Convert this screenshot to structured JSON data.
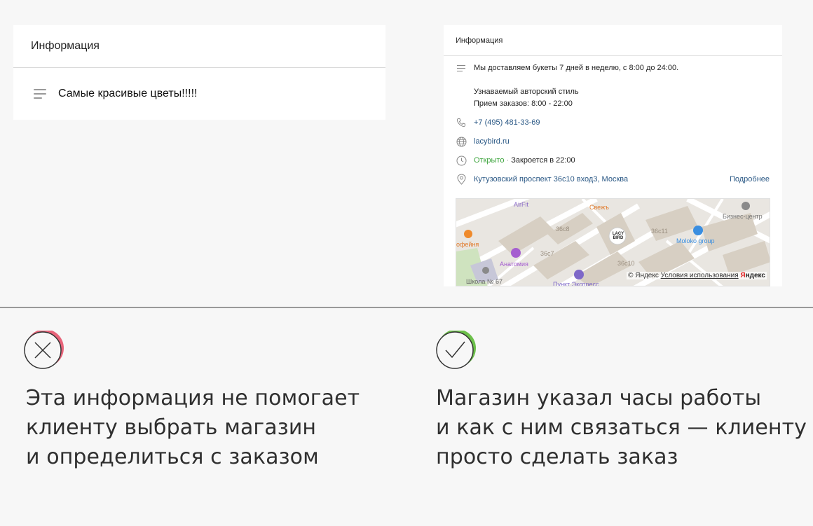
{
  "left_card": {
    "title": "Информация",
    "text": "Самые красивые цветы!!!!!"
  },
  "right_card": {
    "title": "Информация",
    "description_line1": "Мы доставляем букеты 7 дней в неделю, с 8:00 до 24:00.",
    "description_line2": "Узнаваемый авторский стиль",
    "description_line3": "Прием заказов: 8:00 - 22:00",
    "phone": "+7 (495) 481-33-69",
    "website": "lacybird.ru",
    "open_status": "Открыто",
    "separator": " · ",
    "closes": "Закроется в 22:00",
    "address": "Кутузовский проспект 36с10 вход3, Москва",
    "more_link": "Подробнее",
    "map": {
      "labels": {
        "airfit": "AirFit",
        "svezh": "Свежъ",
        "business_center": "Бизнес-центр",
        "b36c8": "36с8",
        "b36c11": "36с11",
        "b36c7": "36с7",
        "b36c10": "36с10",
        "coffee": "офейня",
        "anatomy": "Анатомия",
        "moloko": "Moloko group",
        "school": "Школа № 67",
        "point": "Пункт Экспресс",
        "logo": "LACY BIRD"
      },
      "credit_prefix": "© Яндекс",
      "terms": "Условия использования",
      "brand_red": "Я",
      "brand_rest": "ндекс"
    }
  },
  "bad_example": {
    "icon": "cross-icon",
    "accent": "#e8647a",
    "caption": [
      "Эта информация не помогает",
      "клиенту выбрать магазин",
      "и определиться с заказом"
    ]
  },
  "good_example": {
    "icon": "check-icon",
    "accent": "#6cc04a",
    "caption": [
      "Магазин указал часы работы",
      "и как с ним связаться — клиенту",
      "просто сделать заказ"
    ]
  }
}
